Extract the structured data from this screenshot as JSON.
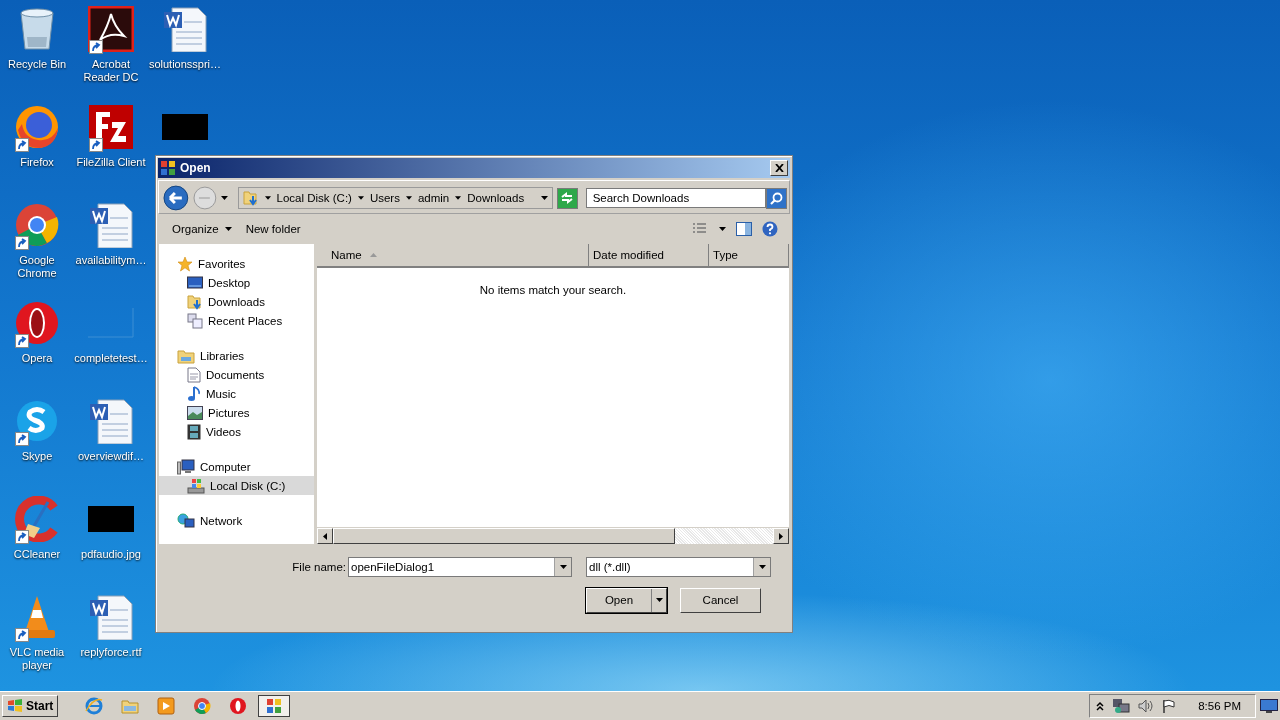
{
  "desktop": {
    "icons": [
      {
        "label": "Recycle Bin",
        "kind": "recycle",
        "shortcut": false
      },
      {
        "label": "Firefox",
        "kind": "firefox",
        "shortcut": true
      },
      {
        "label": "Google Chrome",
        "kind": "chrome",
        "shortcut": true
      },
      {
        "label": "Opera",
        "kind": "opera",
        "shortcut": true
      },
      {
        "label": "Skype",
        "kind": "skype",
        "shortcut": true
      },
      {
        "label": "CCleaner",
        "kind": "ccleaner",
        "shortcut": true
      },
      {
        "label": "VLC media player",
        "kind": "vlc",
        "shortcut": true
      },
      {
        "label": "Acrobat Reader DC",
        "kind": "acrobat",
        "shortcut": true
      },
      {
        "label": "FileZilla Client",
        "kind": "filezilla",
        "shortcut": true
      },
      {
        "label": "availabilitym…",
        "kind": "word",
        "shortcut": false
      },
      {
        "label": "completetest…",
        "kind": "blank",
        "shortcut": false
      },
      {
        "label": "overviewdif…",
        "kind": "word",
        "shortcut": false
      },
      {
        "label": "pdfaudio.jpg",
        "kind": "dark",
        "shortcut": false
      },
      {
        "label": "replyforce.rtf",
        "kind": "word",
        "shortcut": false
      },
      {
        "label": "solutionsspri…",
        "kind": "word",
        "shortcut": false
      },
      {
        "kind": "dark",
        "shortcut": false
      }
    ]
  },
  "dialog": {
    "title": "Open",
    "address": [
      "Local Disk (C:)",
      "Users",
      "admin",
      "Downloads"
    ],
    "search": {
      "placeholder": "Search Downloads"
    },
    "toolbar": [
      {
        "label": "Organize",
        "dropdown": true
      },
      {
        "label": "New folder",
        "dropdown": false
      }
    ],
    "nav": [
      {
        "label": "Favorites",
        "kind": "star",
        "selected": false,
        "children": [
          {
            "label": "Desktop",
            "kind": "desktop",
            "selected": false
          },
          {
            "label": "Downloads",
            "kind": "downloads",
            "selected": false
          },
          {
            "label": "Recent Places",
            "kind": "recent",
            "selected": false
          }
        ]
      },
      {
        "label": "Libraries",
        "kind": "library",
        "selected": false,
        "children": [
          {
            "label": "Documents",
            "kind": "documents",
            "selected": false
          },
          {
            "label": "Music",
            "kind": "music",
            "selected": false
          },
          {
            "label": "Pictures",
            "kind": "pictures",
            "selected": false
          },
          {
            "label": "Videos",
            "kind": "videos",
            "selected": false
          }
        ]
      },
      {
        "label": "Computer",
        "kind": "computer",
        "selected": false,
        "children": [
          {
            "label": "Local Disk (C:)",
            "kind": "drive",
            "selected": true
          }
        ]
      },
      {
        "label": "Network",
        "kind": "network",
        "selected": false
      }
    ],
    "columns": [
      {
        "label": "Name",
        "sorted": true
      },
      {
        "label": "Date modified",
        "sorted": false
      },
      {
        "label": "Type",
        "sorted": false
      }
    ],
    "empty_message": "No items match your search.",
    "file_name": {
      "label": "File name:",
      "value": "openFileDialog1"
    },
    "filter": {
      "value": "dll (*.dll)"
    },
    "buttons": [
      {
        "label": "Open",
        "kind": "split"
      },
      {
        "label": "Cancel",
        "kind": "plain"
      }
    ]
  },
  "taskbar": {
    "start": "Start",
    "apps": [
      {
        "kind": "ie",
        "selected": false
      },
      {
        "kind": "explorer",
        "selected": false
      },
      {
        "kind": "media",
        "selected": false
      },
      {
        "kind": "chrome",
        "selected": false
      },
      {
        "kind": "opera",
        "selected": false
      },
      {
        "kind": "dialog",
        "selected": true
      }
    ],
    "clock": "8:56 PM"
  }
}
